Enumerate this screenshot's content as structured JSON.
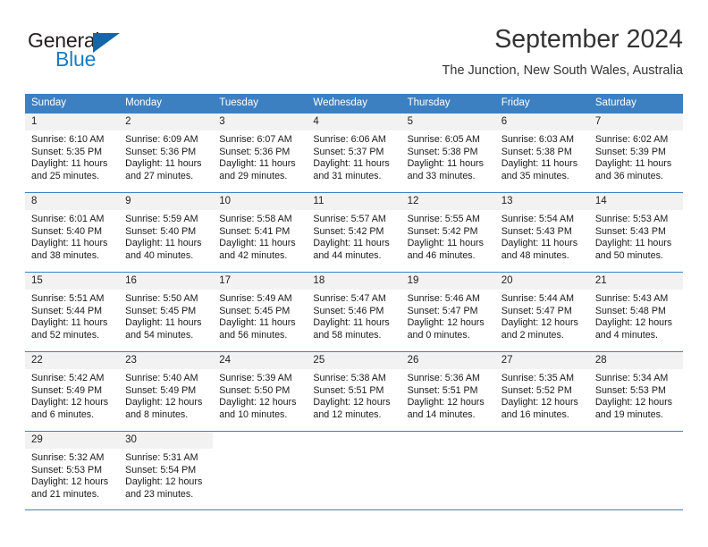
{
  "brand": {
    "name_top": "General",
    "name_bottom": "Blue",
    "triangle_color": "#1565a8",
    "blue_color": "#1a7bc4"
  },
  "header": {
    "title": "September 2024",
    "subtitle": "The Junction, New South Wales, Australia"
  },
  "calendar": {
    "header_bg": "#3d80c2",
    "daynum_bg": "#f2f2f2",
    "weekday_headers": [
      "Sunday",
      "Monday",
      "Tuesday",
      "Wednesday",
      "Thursday",
      "Friday",
      "Saturday"
    ],
    "weeks": [
      [
        {
          "day": "1",
          "sunrise": "Sunrise: 6:10 AM",
          "sunset": "Sunset: 5:35 PM",
          "daylight1": "Daylight: 11 hours",
          "daylight2": "and 25 minutes."
        },
        {
          "day": "2",
          "sunrise": "Sunrise: 6:09 AM",
          "sunset": "Sunset: 5:36 PM",
          "daylight1": "Daylight: 11 hours",
          "daylight2": "and 27 minutes."
        },
        {
          "day": "3",
          "sunrise": "Sunrise: 6:07 AM",
          "sunset": "Sunset: 5:36 PM",
          "daylight1": "Daylight: 11 hours",
          "daylight2": "and 29 minutes."
        },
        {
          "day": "4",
          "sunrise": "Sunrise: 6:06 AM",
          "sunset": "Sunset: 5:37 PM",
          "daylight1": "Daylight: 11 hours",
          "daylight2": "and 31 minutes."
        },
        {
          "day": "5",
          "sunrise": "Sunrise: 6:05 AM",
          "sunset": "Sunset: 5:38 PM",
          "daylight1": "Daylight: 11 hours",
          "daylight2": "and 33 minutes."
        },
        {
          "day": "6",
          "sunrise": "Sunrise: 6:03 AM",
          "sunset": "Sunset: 5:38 PM",
          "daylight1": "Daylight: 11 hours",
          "daylight2": "and 35 minutes."
        },
        {
          "day": "7",
          "sunrise": "Sunrise: 6:02 AM",
          "sunset": "Sunset: 5:39 PM",
          "daylight1": "Daylight: 11 hours",
          "daylight2": "and 36 minutes."
        }
      ],
      [
        {
          "day": "8",
          "sunrise": "Sunrise: 6:01 AM",
          "sunset": "Sunset: 5:40 PM",
          "daylight1": "Daylight: 11 hours",
          "daylight2": "and 38 minutes."
        },
        {
          "day": "9",
          "sunrise": "Sunrise: 5:59 AM",
          "sunset": "Sunset: 5:40 PM",
          "daylight1": "Daylight: 11 hours",
          "daylight2": "and 40 minutes."
        },
        {
          "day": "10",
          "sunrise": "Sunrise: 5:58 AM",
          "sunset": "Sunset: 5:41 PM",
          "daylight1": "Daylight: 11 hours",
          "daylight2": "and 42 minutes."
        },
        {
          "day": "11",
          "sunrise": "Sunrise: 5:57 AM",
          "sunset": "Sunset: 5:42 PM",
          "daylight1": "Daylight: 11 hours",
          "daylight2": "and 44 minutes."
        },
        {
          "day": "12",
          "sunrise": "Sunrise: 5:55 AM",
          "sunset": "Sunset: 5:42 PM",
          "daylight1": "Daylight: 11 hours",
          "daylight2": "and 46 minutes."
        },
        {
          "day": "13",
          "sunrise": "Sunrise: 5:54 AM",
          "sunset": "Sunset: 5:43 PM",
          "daylight1": "Daylight: 11 hours",
          "daylight2": "and 48 minutes."
        },
        {
          "day": "14",
          "sunrise": "Sunrise: 5:53 AM",
          "sunset": "Sunset: 5:43 PM",
          "daylight1": "Daylight: 11 hours",
          "daylight2": "and 50 minutes."
        }
      ],
      [
        {
          "day": "15",
          "sunrise": "Sunrise: 5:51 AM",
          "sunset": "Sunset: 5:44 PM",
          "daylight1": "Daylight: 11 hours",
          "daylight2": "and 52 minutes."
        },
        {
          "day": "16",
          "sunrise": "Sunrise: 5:50 AM",
          "sunset": "Sunset: 5:45 PM",
          "daylight1": "Daylight: 11 hours",
          "daylight2": "and 54 minutes."
        },
        {
          "day": "17",
          "sunrise": "Sunrise: 5:49 AM",
          "sunset": "Sunset: 5:45 PM",
          "daylight1": "Daylight: 11 hours",
          "daylight2": "and 56 minutes."
        },
        {
          "day": "18",
          "sunrise": "Sunrise: 5:47 AM",
          "sunset": "Sunset: 5:46 PM",
          "daylight1": "Daylight: 11 hours",
          "daylight2": "and 58 minutes."
        },
        {
          "day": "19",
          "sunrise": "Sunrise: 5:46 AM",
          "sunset": "Sunset: 5:47 PM",
          "daylight1": "Daylight: 12 hours",
          "daylight2": "and 0 minutes."
        },
        {
          "day": "20",
          "sunrise": "Sunrise: 5:44 AM",
          "sunset": "Sunset: 5:47 PM",
          "daylight1": "Daylight: 12 hours",
          "daylight2": "and 2 minutes."
        },
        {
          "day": "21",
          "sunrise": "Sunrise: 5:43 AM",
          "sunset": "Sunset: 5:48 PM",
          "daylight1": "Daylight: 12 hours",
          "daylight2": "and 4 minutes."
        }
      ],
      [
        {
          "day": "22",
          "sunrise": "Sunrise: 5:42 AM",
          "sunset": "Sunset: 5:49 PM",
          "daylight1": "Daylight: 12 hours",
          "daylight2": "and 6 minutes."
        },
        {
          "day": "23",
          "sunrise": "Sunrise: 5:40 AM",
          "sunset": "Sunset: 5:49 PM",
          "daylight1": "Daylight: 12 hours",
          "daylight2": "and 8 minutes."
        },
        {
          "day": "24",
          "sunrise": "Sunrise: 5:39 AM",
          "sunset": "Sunset: 5:50 PM",
          "daylight1": "Daylight: 12 hours",
          "daylight2": "and 10 minutes."
        },
        {
          "day": "25",
          "sunrise": "Sunrise: 5:38 AM",
          "sunset": "Sunset: 5:51 PM",
          "daylight1": "Daylight: 12 hours",
          "daylight2": "and 12 minutes."
        },
        {
          "day": "26",
          "sunrise": "Sunrise: 5:36 AM",
          "sunset": "Sunset: 5:51 PM",
          "daylight1": "Daylight: 12 hours",
          "daylight2": "and 14 minutes."
        },
        {
          "day": "27",
          "sunrise": "Sunrise: 5:35 AM",
          "sunset": "Sunset: 5:52 PM",
          "daylight1": "Daylight: 12 hours",
          "daylight2": "and 16 minutes."
        },
        {
          "day": "28",
          "sunrise": "Sunrise: 5:34 AM",
          "sunset": "Sunset: 5:53 PM",
          "daylight1": "Daylight: 12 hours",
          "daylight2": "and 19 minutes."
        }
      ],
      [
        {
          "day": "29",
          "sunrise": "Sunrise: 5:32 AM",
          "sunset": "Sunset: 5:53 PM",
          "daylight1": "Daylight: 12 hours",
          "daylight2": "and 21 minutes."
        },
        {
          "day": "30",
          "sunrise": "Sunrise: 5:31 AM",
          "sunset": "Sunset: 5:54 PM",
          "daylight1": "Daylight: 12 hours",
          "daylight2": "and 23 minutes."
        },
        {
          "day": "",
          "sunrise": "",
          "sunset": "",
          "daylight1": "",
          "daylight2": ""
        },
        {
          "day": "",
          "sunrise": "",
          "sunset": "",
          "daylight1": "",
          "daylight2": ""
        },
        {
          "day": "",
          "sunrise": "",
          "sunset": "",
          "daylight1": "",
          "daylight2": ""
        },
        {
          "day": "",
          "sunrise": "",
          "sunset": "",
          "daylight1": "",
          "daylight2": ""
        },
        {
          "day": "",
          "sunrise": "",
          "sunset": "",
          "daylight1": "",
          "daylight2": ""
        }
      ]
    ]
  }
}
